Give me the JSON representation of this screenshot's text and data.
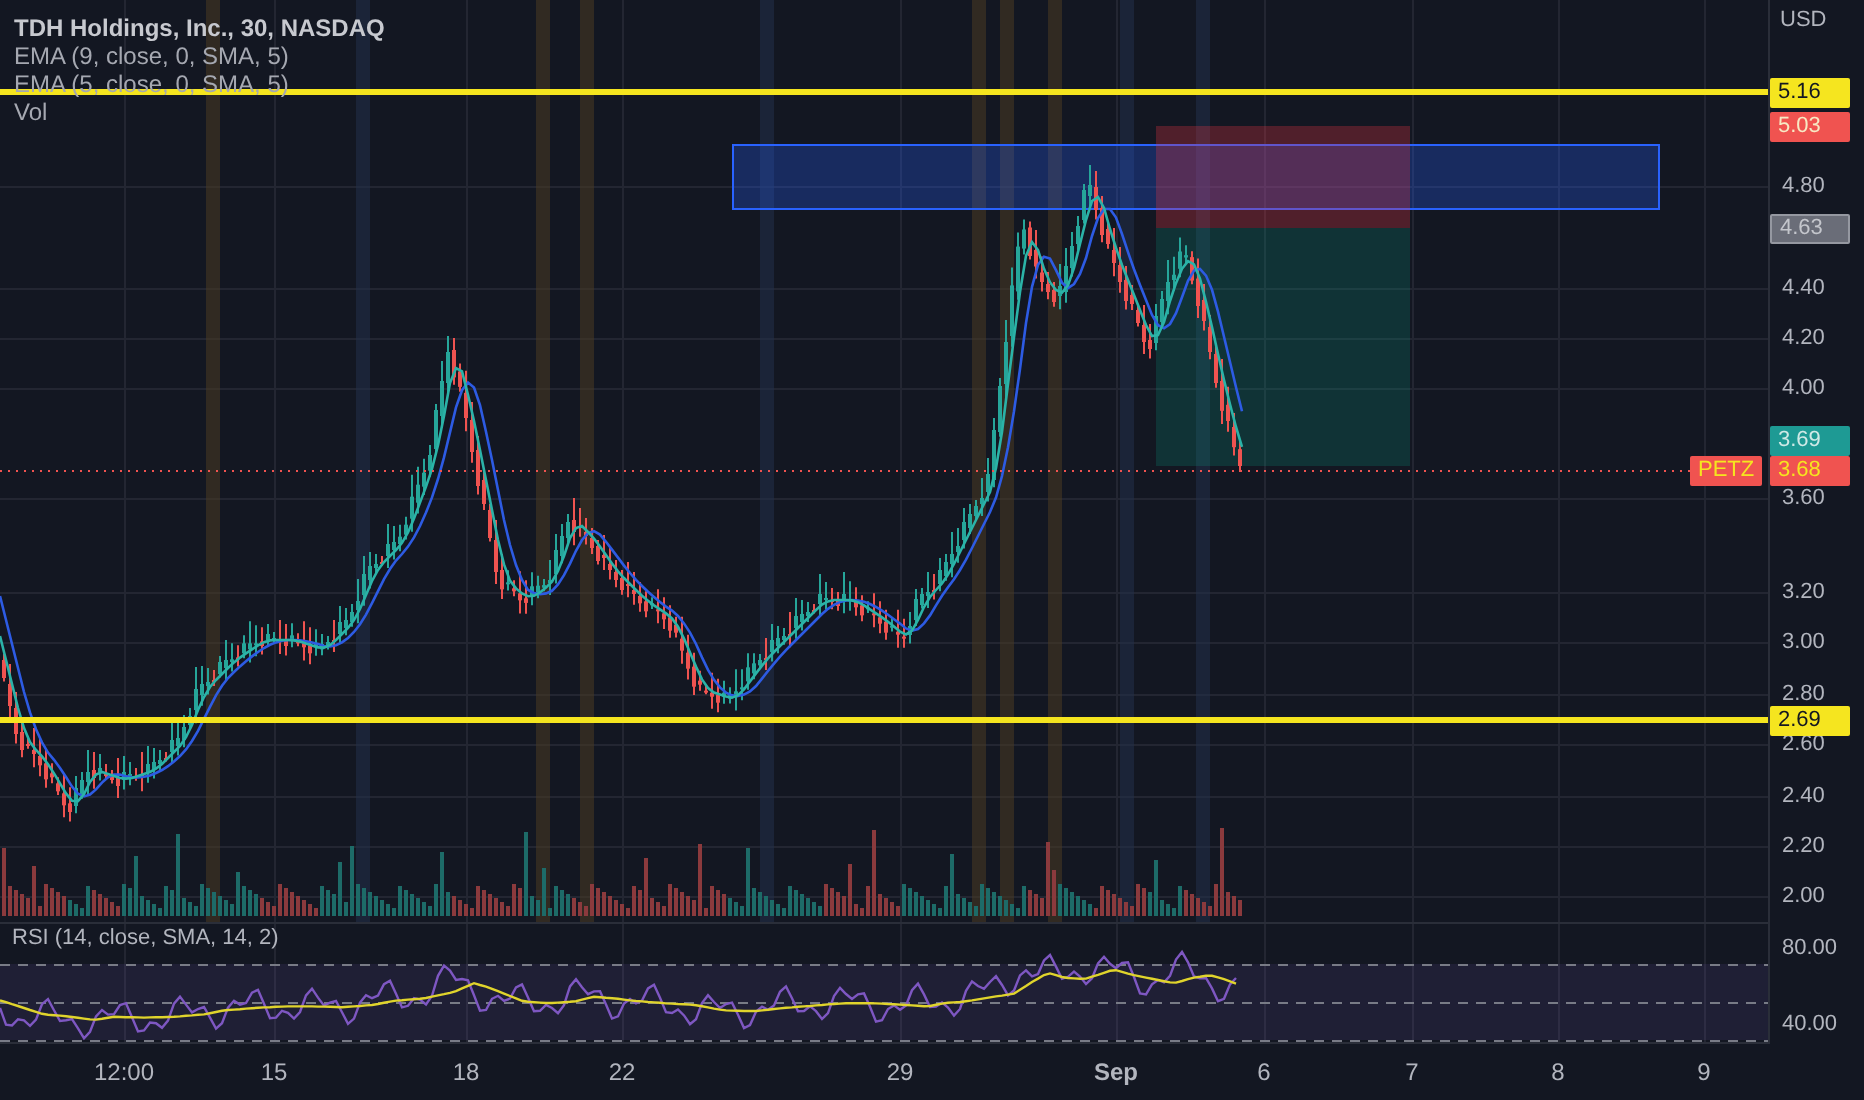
{
  "legend": {
    "title": "TDH Holdings, Inc., 30, NASDAQ",
    "studies": [
      "EMA (9, close, 0, SMA, 5)",
      "EMA (5, close, 0, SMA, 5)",
      "Vol"
    ]
  },
  "price_axis": {
    "currency": "USD",
    "ticks": [
      "4.80",
      "4.40",
      "4.20",
      "4.00",
      "3.60",
      "3.20",
      "3.00",
      "2.80",
      "2.60",
      "2.40",
      "2.20",
      "2.00"
    ]
  },
  "badges": [
    {
      "kind": "level",
      "text": "5.16",
      "color": "#f5e51f"
    },
    {
      "kind": "stop",
      "text": "5.03",
      "color": "#f05350"
    },
    {
      "kind": "entry",
      "text": "4.63",
      "color": "#6a6d78"
    },
    {
      "kind": "target",
      "text": "3.69",
      "color": "#1e9a94"
    },
    {
      "kind": "last",
      "label": "PETZ",
      "text": "3.68",
      "color": "#f05350"
    },
    {
      "kind": "level",
      "text": "2.69",
      "color": "#f5e51f"
    }
  ],
  "rsi": {
    "title": "RSI (14, close, SMA, 14, 2)",
    "ticks": [
      "80.00",
      "40.00"
    ]
  },
  "time_axis": [
    {
      "kind": "time",
      "text": "12:00"
    },
    {
      "kind": "day",
      "text": "15"
    },
    {
      "kind": "day",
      "text": "18"
    },
    {
      "kind": "day",
      "text": "22"
    },
    {
      "kind": "day",
      "text": "29"
    },
    {
      "kind": "month",
      "text": "Sep"
    },
    {
      "kind": "day",
      "text": "6"
    },
    {
      "kind": "day",
      "text": "7"
    },
    {
      "kind": "day",
      "text": "8"
    },
    {
      "kind": "day",
      "text": "9"
    }
  ]
}
